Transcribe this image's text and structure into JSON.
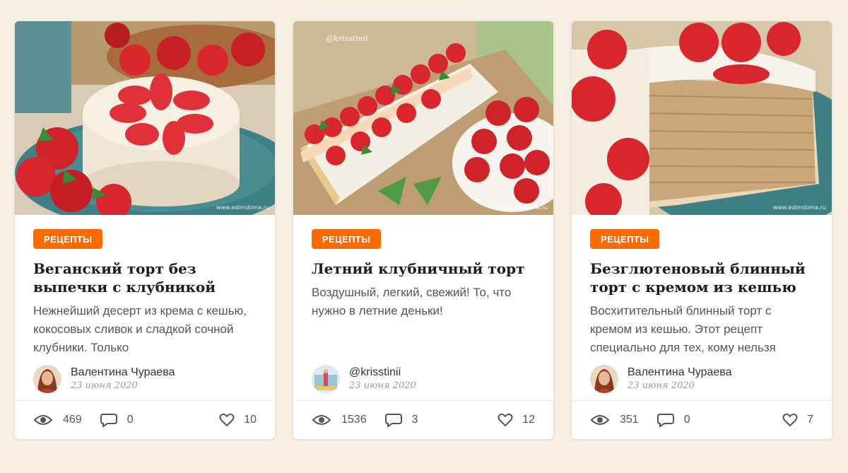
{
  "cards": [
    {
      "tag": "РЕЦЕПТЫ",
      "title": "Веганский торт без выпечки с клубникой",
      "description": "Нежнейший десерт из крема с кешью, кокосовых сливок и сладкой сочной клубники. Только",
      "author": "Валентина Чураева",
      "date": "23 июня 2020",
      "views": "469",
      "comments": "0",
      "likes": "10",
      "watermark": "www.edimdoma.ru",
      "image_icon": "vegan-strawberry-cake-photo"
    },
    {
      "tag": "РЕЦЕПТЫ",
      "title": "Летний клубничный торт",
      "description": "Воздушный, легкий, свежий! То, что нужно в летние деньки!",
      "author": "@krisstinii",
      "date": "23 июня 2020",
      "views": "1536",
      "comments": "3",
      "likes": "12",
      "watermark": "www.edimdoma.ru",
      "watermark_top": "@krisstinii",
      "image_icon": "summer-strawberry-cake-photo"
    },
    {
      "tag": "РЕЦЕПТЫ",
      "title": "Безглютеновый блинный торт с кремом из кешью",
      "description": "Восхитительный блинный торт с кремом из кешью. Этот рецепт специально для тех, кому нельзя",
      "author": "Валентина Чураева",
      "date": "23 июня 2020",
      "views": "351",
      "comments": "0",
      "likes": "7",
      "watermark": "www.edimdoma.ru",
      "image_icon": "gluten-free-crepe-cake-photo"
    }
  ],
  "colors": {
    "tag_bg": "#ff6a00",
    "page_bg": "#f6efe3",
    "plate_teal": "#3f7f86",
    "strawberry": "#d8262c"
  },
  "icons": {
    "views": "eye-icon",
    "comments": "speech-bubble-icon",
    "likes": "heart-icon"
  }
}
